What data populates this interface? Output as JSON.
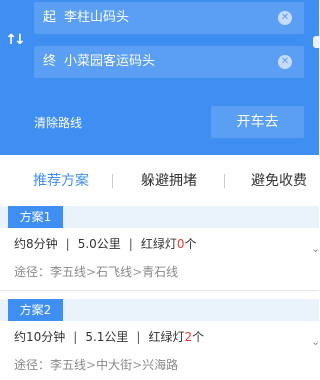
{
  "route": {
    "start_prefix": "起",
    "start_value": "李柱山码头",
    "end_prefix": "终",
    "end_value": "小菜园客运码头",
    "clear_route_label": "清除路线",
    "go_label": "开车去"
  },
  "tabs": [
    {
      "label": "推荐方案",
      "active": true
    },
    {
      "label": "躲避拥堵",
      "active": false
    },
    {
      "label": "避免收费",
      "active": false
    }
  ],
  "plans": [
    {
      "badge": "方案1",
      "time": "约8分钟",
      "distance": "5.0公里",
      "lights_prefix": "红绿灯",
      "lights_count": "0",
      "lights_suffix": "个",
      "via_label": "途径：",
      "via": [
        "李五线",
        "石飞线",
        "青石线"
      ]
    },
    {
      "badge": "方案2",
      "time": "约10分钟",
      "distance": "5.1公里",
      "lights_prefix": "红绿灯",
      "lights_count": "2",
      "lights_suffix": "个",
      "via_label": "途径：",
      "via": [
        "李五线",
        "中大街",
        "兴海路"
      ]
    }
  ],
  "colors": {
    "header_bg": "#3f8ff3",
    "accent": "#3f8ff3",
    "light_count": "#e53935"
  },
  "icons": {
    "swap": "swap-vertical-icon",
    "clear": "clear-circle-icon",
    "expand": "chevron-down-icon"
  }
}
